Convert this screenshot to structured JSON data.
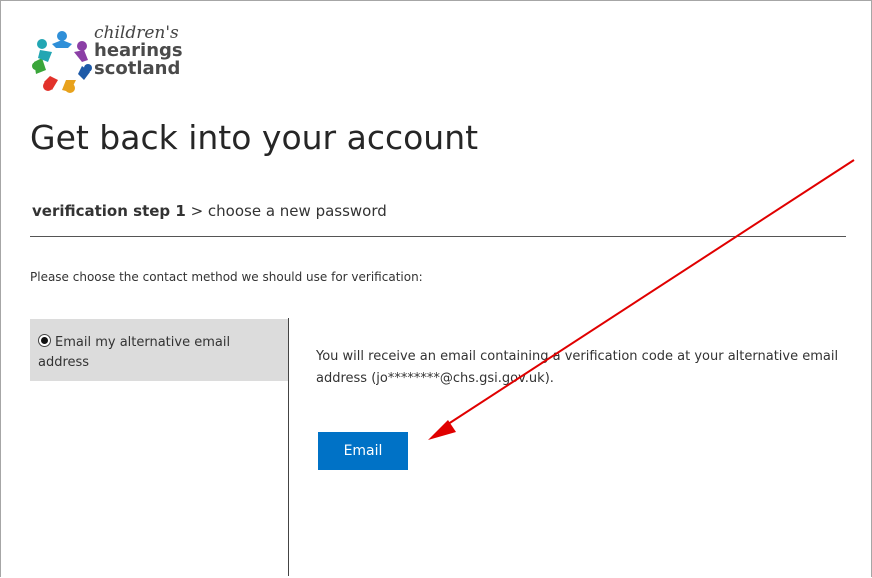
{
  "logo": {
    "line1": "children's",
    "line2": "hearings",
    "line3": "scotland"
  },
  "page": {
    "title": "Get back into your account"
  },
  "steps": {
    "current": "verification step 1",
    "separator": " > ",
    "next": "choose a new password"
  },
  "instruction": "Please choose the contact method we should use for verification:",
  "methods": [
    {
      "label": "Email my alternative email address",
      "selected": true
    }
  ],
  "info": "You will receive an email containing a verification code at your alternative email address (jo********@chs.gsi.gov.uk).",
  "actions": {
    "email_label": "Email"
  },
  "colors": {
    "accent": "#0072c6",
    "annotation_arrow": "#e00000",
    "method_bg": "#dcdcdc"
  }
}
